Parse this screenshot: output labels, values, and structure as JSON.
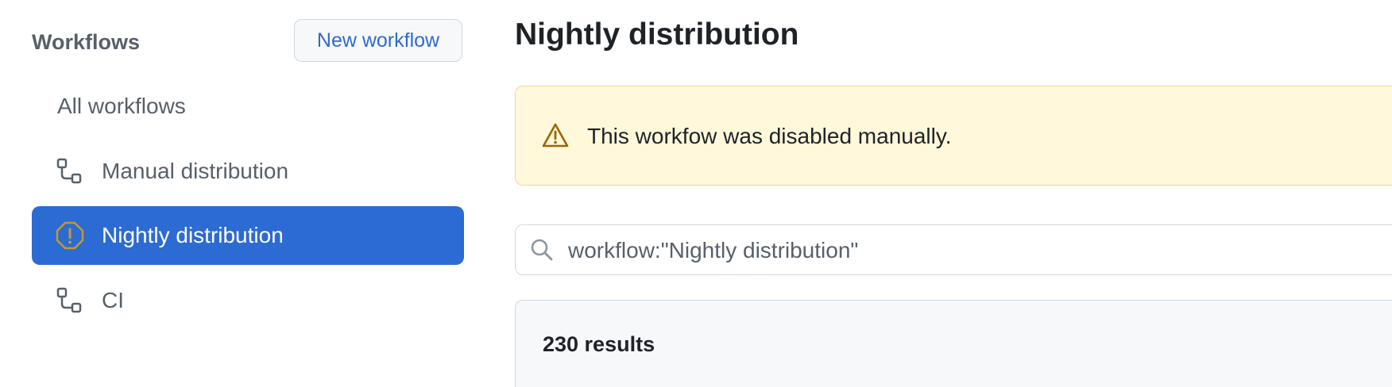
{
  "sidebar": {
    "title": "Workflows",
    "new_workflow_label": "New workflow",
    "items": [
      {
        "label": "All workflows",
        "icon": "none"
      },
      {
        "label": "Manual distribution",
        "icon": "workflow-icon"
      },
      {
        "label": "Nightly distribution",
        "icon": "disabled-octagon-icon",
        "active": true
      },
      {
        "label": "CI",
        "icon": "workflow-icon"
      }
    ]
  },
  "main": {
    "title": "Nightly distribution",
    "banner": {
      "text": "This workfow was disabled manually.",
      "icon": "alert-triangle-icon"
    },
    "search": {
      "value": "workflow:\"Nightly distribution\"",
      "icon": "search-icon"
    },
    "results": {
      "count_label": "230 results"
    }
  },
  "colors": {
    "active_bg": "#2c6bd3",
    "banner_bg": "#fff8db",
    "banner_border": "#eadb95",
    "warning_icon": "#9a6700",
    "link_blue": "#2f6ad0"
  }
}
